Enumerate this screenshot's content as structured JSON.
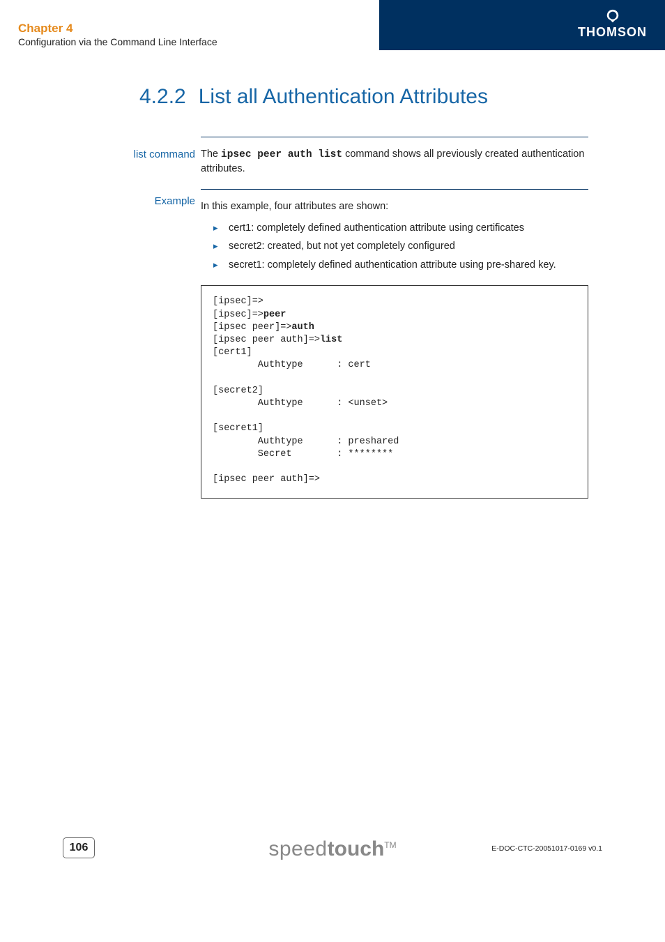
{
  "header": {
    "brand": "THOMSON",
    "chapter_title": "Chapter 4",
    "chapter_subtitle": "Configuration via the Command Line Interface"
  },
  "section": {
    "number": "4.2.2",
    "title": "List all Authentication Attributes"
  },
  "blocks": {
    "list_command": {
      "label": "list command",
      "text_pre": "The ",
      "code": "ipsec peer auth list",
      "text_post": " command shows all previously created authentication attributes."
    },
    "example": {
      "label": "Example",
      "intro": "In this example, four attributes are shown:",
      "bullets": [
        "cert1: completely defined authentication attribute using certificates",
        "secret2: created, but not yet completely configured",
        "secret1: completely defined authentication attribute using pre-shared key."
      ],
      "code": {
        "l1": "[ipsec]=>",
        "l2a": "[ipsec]=>",
        "l2b": "peer",
        "l3a": "[ipsec peer]=>",
        "l3b": "auth",
        "l4a": "[ipsec peer auth]=>",
        "l4b": "list",
        "l5": "[cert1]",
        "l6": "        Authtype      : cert",
        "blank1": "",
        "l7": "[secret2]",
        "l8": "        Authtype      : <unset>",
        "blank2": "",
        "l9": "[secret1]",
        "l10": "        Authtype      : preshared",
        "l11": "        Secret        : ********",
        "blank3": "",
        "l12": "[ipsec peer auth]=>"
      }
    }
  },
  "footer": {
    "page_number": "106",
    "logo_light": "speed",
    "logo_bold": "touch",
    "tm": "TM",
    "doc_id": "E-DOC-CTC-20051017-0169 v0.1"
  }
}
